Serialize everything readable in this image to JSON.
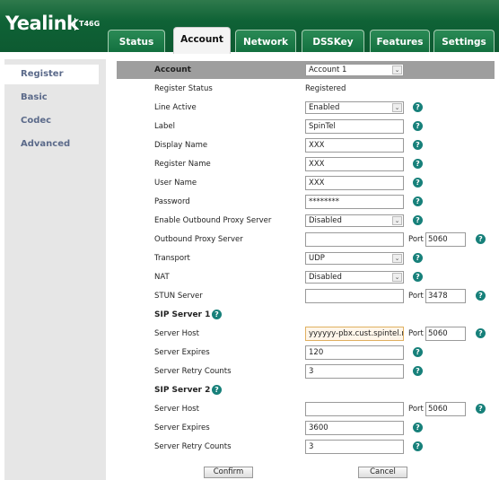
{
  "brand": {
    "logo": "Yealink",
    "model": "T46G"
  },
  "tabs": [
    "Status",
    "Account",
    "Network",
    "DSSKey",
    "Features",
    "Settings"
  ],
  "active_tab": "Account",
  "sidebar": [
    "Register",
    "Basic",
    "Codec",
    "Advanced"
  ],
  "active_side": "Register",
  "colors": {
    "header": "#0f6236",
    "help": "#17807a",
    "accent_label": "#5b6a8a"
  },
  "rows": [
    {
      "label": "Account",
      "type": "select",
      "value": "Account 1",
      "bold": true
    },
    {
      "label": "Register Status",
      "type": "text",
      "value": "Registered"
    },
    {
      "label": "Line Active",
      "type": "select",
      "value": "Enabled",
      "help": true
    },
    {
      "label": "Label",
      "type": "input",
      "value": "SpinTel",
      "help": true
    },
    {
      "label": "Display Name",
      "type": "input",
      "value": "XXX",
      "help": true
    },
    {
      "label": "Register Name",
      "type": "input",
      "value": "XXX",
      "help": true
    },
    {
      "label": "User Name",
      "type": "input",
      "value": "XXX",
      "help": true
    },
    {
      "label": "Password",
      "type": "input",
      "value": "********",
      "help": true
    },
    {
      "label": "Enable Outbound Proxy Server",
      "type": "select",
      "value": "Disabled",
      "help": true
    },
    {
      "label": "Outbound Proxy Server",
      "type": "input",
      "value": "",
      "port": "5060",
      "help": true
    },
    {
      "label": "Transport",
      "type": "select",
      "value": "UDP",
      "help": true
    },
    {
      "label": "NAT",
      "type": "select",
      "value": "Disabled",
      "help": true
    },
    {
      "label": "STUN Server",
      "type": "input",
      "value": "",
      "port": "3478",
      "help": true
    },
    {
      "label": "SIP Server 1",
      "type": "section",
      "help": true
    },
    {
      "label": "Server Host",
      "type": "input",
      "value": "yyyyyy-pbx.cust.spintel.net.au",
      "port": "5060",
      "help": true,
      "focus": true
    },
    {
      "label": "Server Expires",
      "type": "input",
      "value": "120",
      "help": true
    },
    {
      "label": "Server Retry Counts",
      "type": "input",
      "value": "3",
      "help": true
    },
    {
      "label": "SIP Server 2",
      "type": "section",
      "help": true
    },
    {
      "label": "Server Host",
      "type": "input",
      "value": "",
      "port": "5060",
      "help": true
    },
    {
      "label": "Server Expires",
      "type": "input",
      "value": "3600",
      "help": true
    },
    {
      "label": "Server Retry Counts",
      "type": "input",
      "value": "3",
      "help": true
    }
  ],
  "port_label": "Port",
  "help_glyph": "?",
  "select_arrow": "⌄",
  "buttons": {
    "confirm": "Confirm",
    "cancel": "Cancel"
  }
}
